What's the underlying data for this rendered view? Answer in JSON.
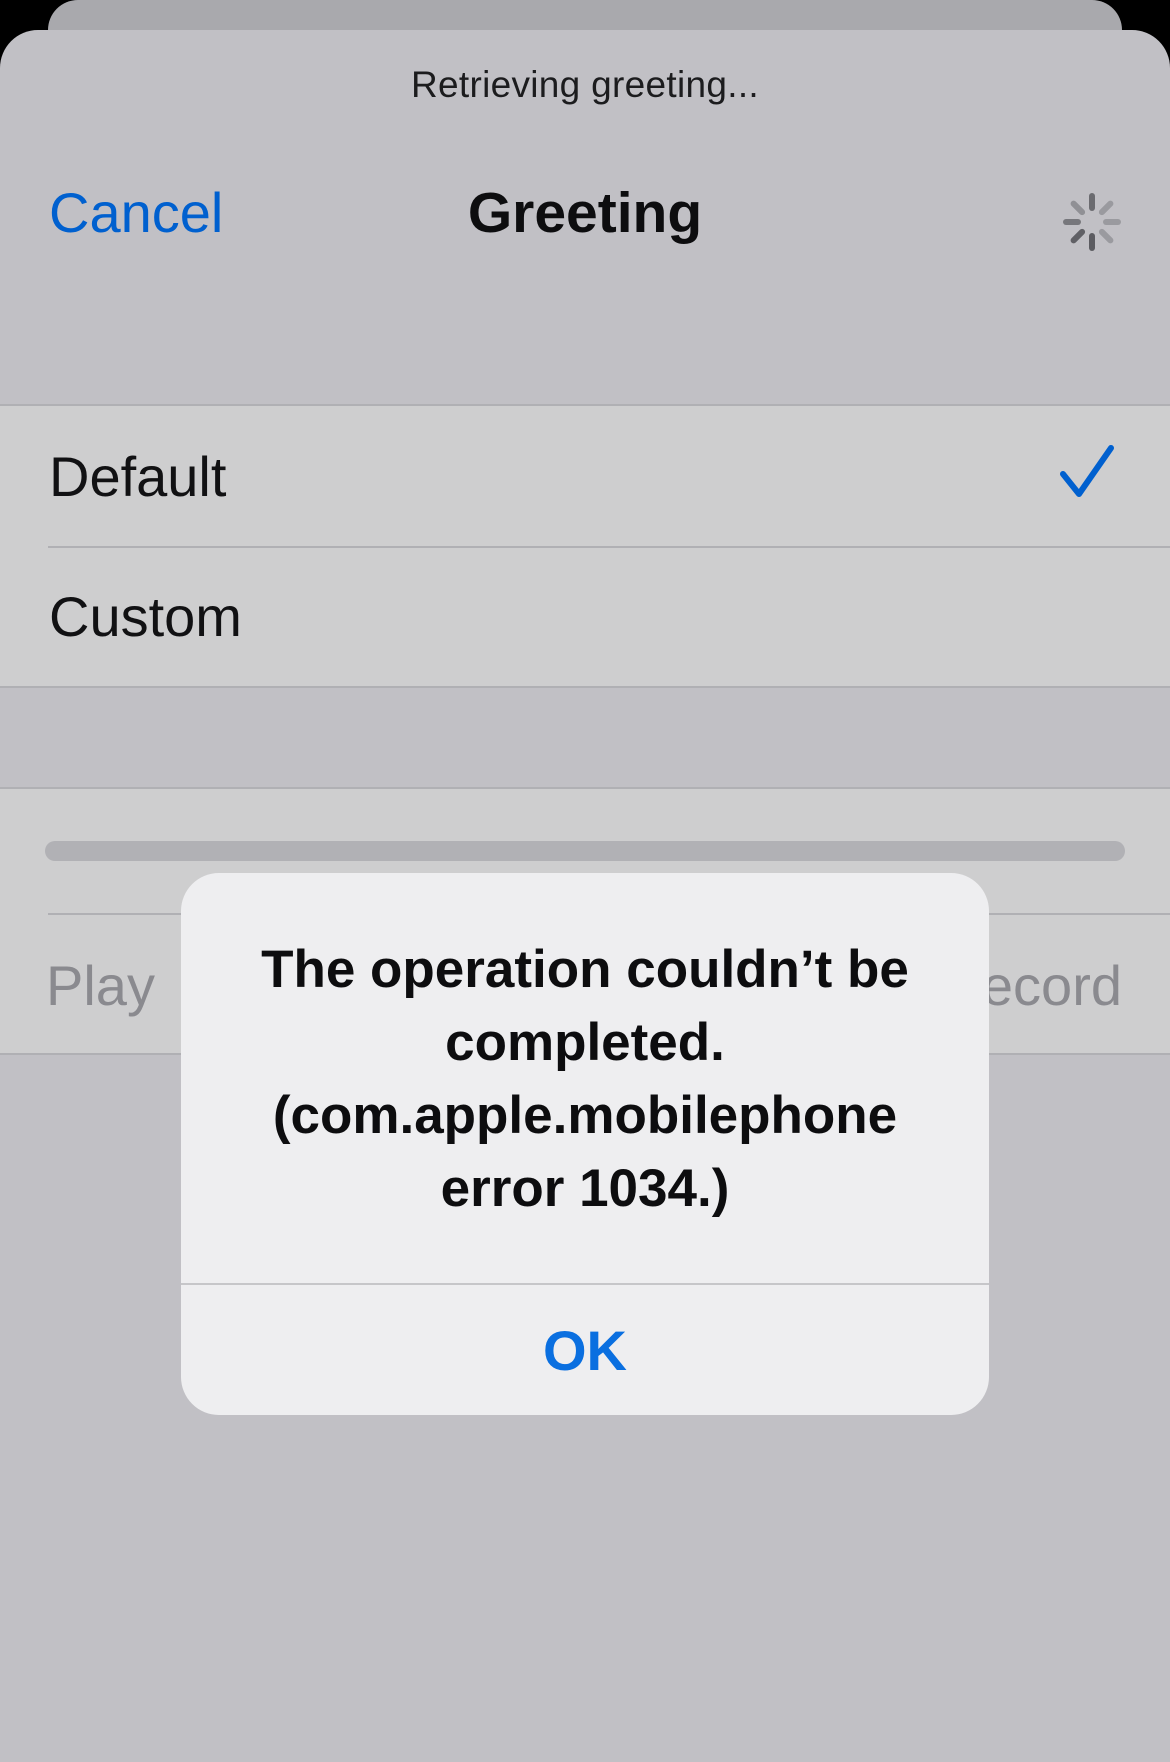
{
  "status": {
    "text": "Retrieving greeting..."
  },
  "nav": {
    "cancel_label": "Cancel",
    "title": "Greeting",
    "activity_indicator_icon": "spinner-icon"
  },
  "options": [
    {
      "label": "Default",
      "selected": true
    },
    {
      "label": "Custom",
      "selected": false
    }
  ],
  "playback": {
    "play_label": "Play",
    "record_label": "Record",
    "progress_fraction": 0.0
  },
  "alert": {
    "message": "The operation couldn’t be completed. (com.apple.mobilephone error 1034.)",
    "ok_label": "OK"
  },
  "colors": {
    "accent": "#0060cf",
    "alert_button": "#0a6fe0",
    "sheet_background": "#c1c0c5",
    "alert_background": "#eeeef0"
  }
}
